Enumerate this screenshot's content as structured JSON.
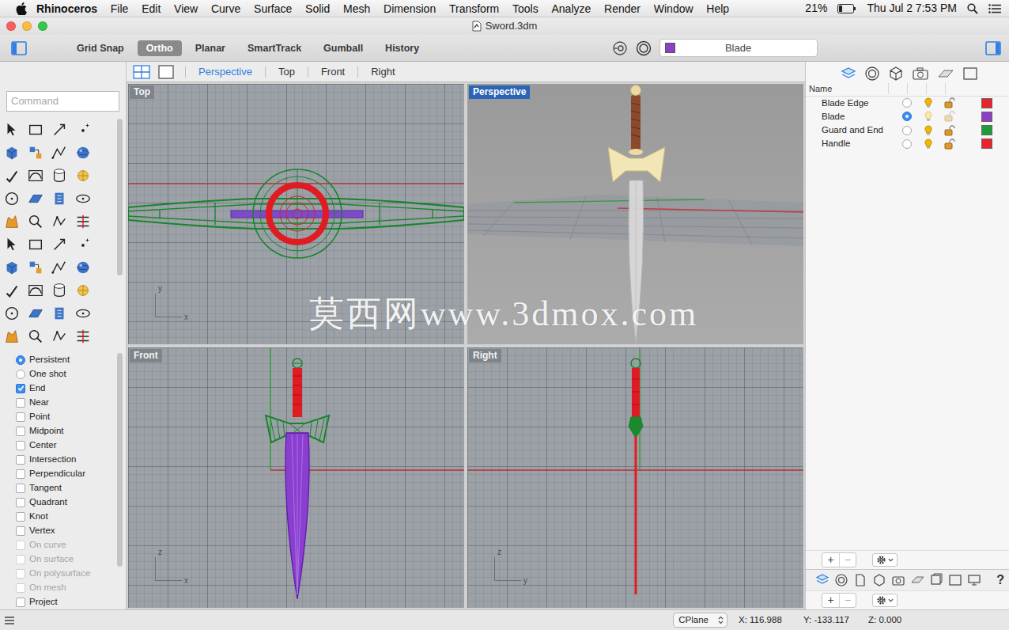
{
  "menubar": {
    "app": "Rhinoceros",
    "menus": [
      "File",
      "Edit",
      "View",
      "Curve",
      "Surface",
      "Solid",
      "Mesh",
      "Dimension",
      "Transform",
      "Tools",
      "Analyze",
      "Render",
      "Window",
      "Help"
    ],
    "battery": "21%",
    "clock": "Thu Jul 2 7:53 PM"
  },
  "window": {
    "title": "Sword.3dm"
  },
  "toolbar": {
    "toggles": [
      {
        "label": "Grid Snap",
        "selected": false
      },
      {
        "label": "Ortho",
        "selected": true
      },
      {
        "label": "Planar",
        "selected": false
      },
      {
        "label": "SmartTrack",
        "selected": false
      },
      {
        "label": "Gumball",
        "selected": false
      },
      {
        "label": "History",
        "selected": false
      }
    ],
    "layer": {
      "name": "Blade",
      "color": "#8e3fc8"
    }
  },
  "command": {
    "placeholder": "Command"
  },
  "osnap": {
    "modes": [
      {
        "label": "Persistent",
        "selected": true
      },
      {
        "label": "One shot",
        "selected": false
      }
    ],
    "items": [
      {
        "label": "End",
        "checked": true,
        "disabled": false
      },
      {
        "label": "Near",
        "checked": false,
        "disabled": false
      },
      {
        "label": "Point",
        "checked": false,
        "disabled": false
      },
      {
        "label": "Midpoint",
        "checked": false,
        "disabled": false
      },
      {
        "label": "Center",
        "checked": false,
        "disabled": false
      },
      {
        "label": "Intersection",
        "checked": false,
        "disabled": false
      },
      {
        "label": "Perpendicular",
        "checked": false,
        "disabled": false
      },
      {
        "label": "Tangent",
        "checked": false,
        "disabled": false
      },
      {
        "label": "Quadrant",
        "checked": false,
        "disabled": false
      },
      {
        "label": "Knot",
        "checked": false,
        "disabled": false
      },
      {
        "label": "Vertex",
        "checked": false,
        "disabled": false
      },
      {
        "label": "On curve",
        "checked": false,
        "disabled": true
      },
      {
        "label": "On surface",
        "checked": false,
        "disabled": true
      },
      {
        "label": "On polysurface",
        "checked": false,
        "disabled": true
      },
      {
        "label": "On mesh",
        "checked": false,
        "disabled": true
      },
      {
        "label": "Project",
        "checked": false,
        "disabled": false
      }
    ]
  },
  "viewport_tabs": [
    {
      "label": "Perspective",
      "selected": true
    },
    {
      "label": "Top",
      "selected": false
    },
    {
      "label": "Front",
      "selected": false
    },
    {
      "label": "Right",
      "selected": false
    }
  ],
  "viewports": [
    {
      "label": "Top",
      "active": false,
      "kind": "ortho",
      "axes": [
        "y",
        "x"
      ]
    },
    {
      "label": "Perspective",
      "active": true,
      "kind": "perspective",
      "axes": []
    },
    {
      "label": "Front",
      "active": false,
      "kind": "ortho",
      "axes": [
        "z",
        "x"
      ]
    },
    {
      "label": "Right",
      "active": false,
      "kind": "ortho",
      "axes": [
        "z",
        "y"
      ]
    }
  ],
  "watermark": "莫西网www.3dmox.com",
  "layers": {
    "header": "Name",
    "items": [
      {
        "name": "Blade Edge",
        "current": false,
        "color": "#e8232b"
      },
      {
        "name": "Blade",
        "current": true,
        "color": "#8e3fc8"
      },
      {
        "name": "Guard and End",
        "current": false,
        "color": "#1f9c3a"
      },
      {
        "name": "Handle",
        "current": false,
        "color": "#e8232b"
      }
    ]
  },
  "panel_buttons": {
    "add": "+",
    "remove": "−",
    "help": "?"
  },
  "status_bar": {
    "cplane": "CPlane",
    "x": "X: 116.988",
    "y": "Y: -133.117",
    "z": "Z: 0.000"
  }
}
